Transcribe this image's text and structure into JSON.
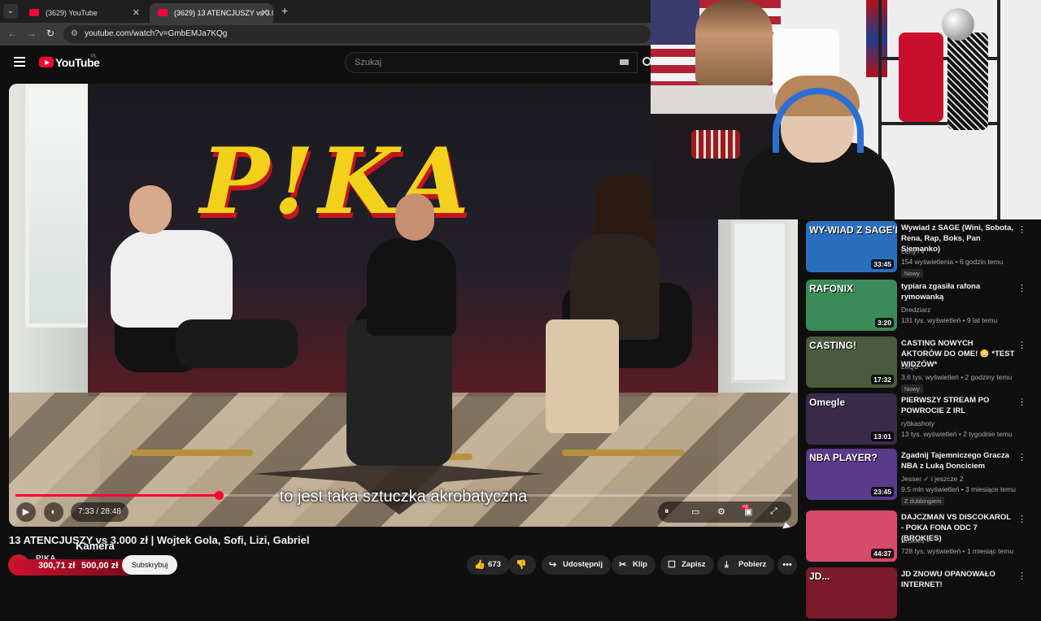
{
  "browser": {
    "tabs": [
      {
        "title": "(3629) YouTube",
        "active": false
      },
      {
        "title": "(3629) 13 ATENCJUSZY vs 3.000",
        "active": true
      }
    ],
    "url": "youtube.com/watch?v=GmbEMJa7KQg"
  },
  "header": {
    "logo_text": "YouTube",
    "country_code": "PL",
    "search_placeholder": "Szukaj"
  },
  "player": {
    "brand_text": "P!KA",
    "subtitle": "to jest taka sztuczka akrobatyczna",
    "time_display": "7:33 / 28:48",
    "progress_fraction": 0.262,
    "quality_badge": "HD"
  },
  "video": {
    "title": "13 ATENCJUSZY vs 3.000 zł | Wojtek Gola, Sofi, Lizi, Gabriel",
    "channel_name": "P!KA",
    "subscribe_label": "Subskrybuj",
    "like_count": "673",
    "share_label": "Udostępnij",
    "clip_label": "Klip",
    "save_label": "Zapisz",
    "download_label": "Pobierz"
  },
  "overlay": {
    "camera_label": "Kamera",
    "amount_1": "300,71 zł",
    "amount_2": "500,00 zł"
  },
  "recommendations": [
    {
      "thumb_text": "WY-WIAD Z SAGE'M",
      "duration": "33:45",
      "title": "Wywiad z SAGE (Wini, Sobota, Rena, Rap, Boks, Pan Siemanko)",
      "channel": "LenyTV",
      "meta": "154 wyświetlenia • 6 godzin temu",
      "badge": "Nowy",
      "thumb_color": "#2a6fbe"
    },
    {
      "thumb_text": "RAFONIX",
      "duration": "3:20",
      "title": "typiara zgasiła rafona rymowanką",
      "channel": "Dredziarz",
      "meta": "131 tys. wyświetleń • 9 lat temu",
      "badge": "",
      "thumb_color": "#3c8a5a"
    },
    {
      "thumb_text": "CASTING!",
      "duration": "17:32",
      "title": "CASTING NOWYCH AKTORÓW DO OME! 😳 *TEST WIDZÓW*",
      "channel": "LeQu",
      "meta": "3,6 tys. wyświetleń • 2 godziny temu",
      "badge": "Nowy",
      "thumb_color": "#4a5a3c"
    },
    {
      "thumb_text": "Omegle",
      "duration": "13:01",
      "title": "PIERWSZY STREAM PO POWROCIE Z IRL",
      "channel": "rybkashoty",
      "meta": "13 tys. wyświetleń • 2 tygodnie temu",
      "badge": "",
      "thumb_color": "#3a2a4a"
    },
    {
      "thumb_text": "NBA PLAYER?",
      "duration": "23:45",
      "title": "Zgadnij Tajemniczego Gracza NBA z Luką Donciciem",
      "channel": "Jesser ✓ i jeszcze 2",
      "meta": "9,5 mln wyświetleń • 3 miesiące temu",
      "badge": "Z dubbingiem",
      "thumb_color": "#5a3a8a"
    },
    {
      "thumb_text": "",
      "duration": "44:37",
      "title": "DAJCZMAN VS DISCOKAROL - POKA FONA ODC 7 (BROKIES)",
      "channel": "Brokies ✓",
      "meta": "728 tys. wyświetleń • 1 miesiąc temu",
      "badge": "",
      "thumb_color": "#d64a6a"
    },
    {
      "thumb_text": "JD...",
      "duration": "",
      "title": "JD ZNOWU OPANOWAŁO INTERNET!",
      "channel": "",
      "meta": "",
      "badge": "",
      "thumb_color": "#7a1a2a"
    }
  ]
}
